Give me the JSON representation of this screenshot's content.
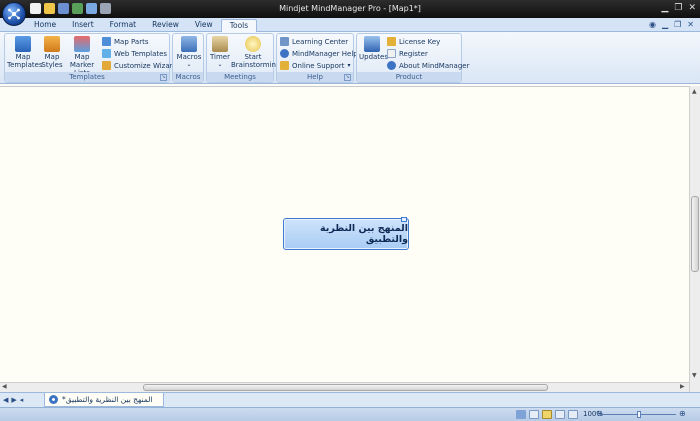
{
  "window": {
    "title": "Mindjet MindManager Pro - [Map1*]"
  },
  "ribbon_tabs": [
    "Home",
    "Insert",
    "Format",
    "Review",
    "View",
    "Tools"
  ],
  "active_tab": "Tools",
  "groups": {
    "templates": {
      "label": "Templates",
      "map_templates": "Map\nTemplates",
      "map_styles": "Map\nStyles",
      "map_marker_lists": "Map Marker\nLists",
      "map_parts": "Map Parts",
      "web_templates": "Web Templates",
      "customize_wizard": "Customize Wizard"
    },
    "macros": {
      "label": "Macros",
      "macros_btn": "Macros"
    },
    "meetings": {
      "label": "Meetings",
      "timer": "Timer",
      "start_brainstorming": "Start\nBrainstorming"
    },
    "help": {
      "label": "Help",
      "learning_center": "Learning Center",
      "mindmanager_help": "MindManager Help",
      "online_support": "Online Support"
    },
    "product": {
      "label": "Product",
      "updates": "Updates",
      "license_key": "License Key",
      "register": "Register",
      "about": "About MindManager"
    }
  },
  "topic": {
    "text": "المنهج بين النظرية والتطبيق"
  },
  "doc_tab": {
    "label": "المنهج بين النظرية والتطبيق*"
  },
  "status": {
    "zoom": "100%"
  },
  "colors": {
    "accent": "#3f7bd1",
    "ribbon": "#dae6f5",
    "canvas": "#fffef6"
  }
}
